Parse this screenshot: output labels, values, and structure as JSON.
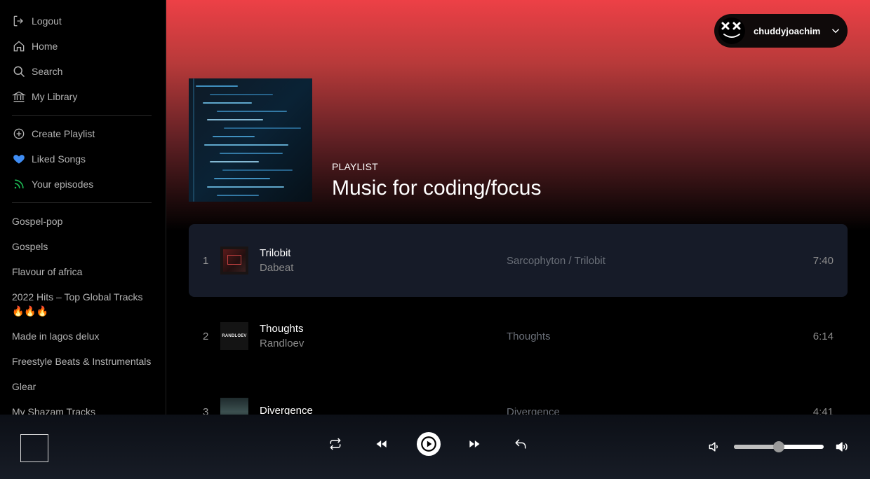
{
  "sidebar": {
    "nav": [
      {
        "label": "Logout",
        "icon": "logout-icon"
      },
      {
        "label": "Home",
        "icon": "home-icon"
      },
      {
        "label": "Search",
        "icon": "search-icon"
      },
      {
        "label": "My Library",
        "icon": "library-icon"
      }
    ],
    "actions": [
      {
        "label": "Create Playlist",
        "icon": "plus-circle-icon"
      },
      {
        "label": "Liked Songs",
        "icon": "heart-icon"
      },
      {
        "label": "Your episodes",
        "icon": "rss-icon"
      }
    ],
    "playlists": [
      "Gospel-pop",
      "Gospels",
      "Flavour of africa",
      "2022 Hits – Top Global Tracks 🔥🔥🔥",
      "Made in lagos delux",
      "Freestyle Beats & Instrumentals",
      "Glear",
      "My Shazam Tracks"
    ]
  },
  "user": {
    "name": "chuddyjoachim"
  },
  "playlist": {
    "type": "PLAYLIST",
    "title": "Music for coding/focus"
  },
  "tracks": [
    {
      "num": "1",
      "title": "Trilobit",
      "artist": "Dabeat",
      "album": "Sarcophyton / Trilobit",
      "duration": "7:40",
      "active": true
    },
    {
      "num": "2",
      "title": "Thoughts",
      "artist": "Randloev",
      "album": "Thoughts",
      "duration": "6:14",
      "active": false,
      "art_text": "RANDLOEV"
    },
    {
      "num": "3",
      "title": "Divergence",
      "artist": "",
      "album": "Divergence",
      "duration": "4:41",
      "active": false
    }
  ],
  "player": {
    "volume_fraction": 0.5
  },
  "colors": {
    "gradient_top": "#ed4046",
    "active_row": "#161b28",
    "liked_icon": "#3f8cf2",
    "episodes_icon": "#1db954"
  }
}
